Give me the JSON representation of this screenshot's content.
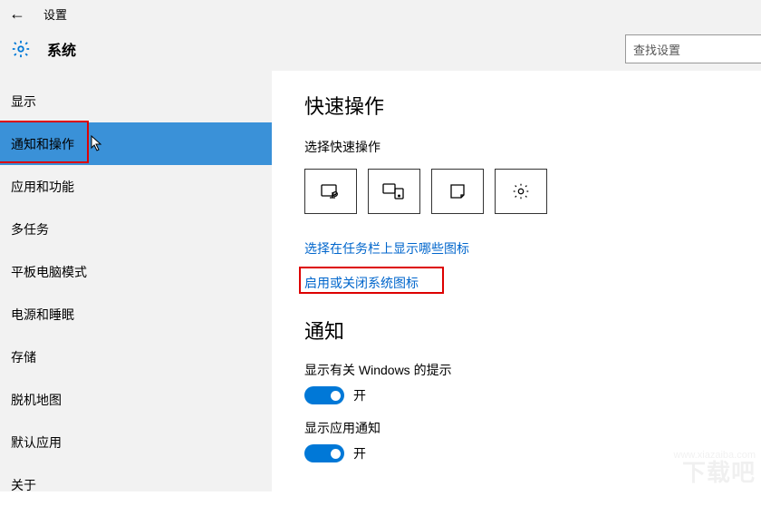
{
  "header": {
    "title": "设置",
    "section": "系统",
    "search_placeholder": "查找设置"
  },
  "sidebar": {
    "items": [
      {
        "label": "显示"
      },
      {
        "label": "通知和操作"
      },
      {
        "label": "应用和功能"
      },
      {
        "label": "多任务"
      },
      {
        "label": "平板电脑模式"
      },
      {
        "label": "电源和睡眠"
      },
      {
        "label": "存储"
      },
      {
        "label": "脱机地图"
      },
      {
        "label": "默认应用"
      },
      {
        "label": "关于"
      }
    ],
    "selected_index": 1
  },
  "content": {
    "quick_actions_heading": "快速操作",
    "quick_actions_sub": "选择快速操作",
    "tiles": [
      "tablet-mode-icon",
      "connect-icon",
      "note-icon",
      "settings-icon"
    ],
    "link_taskbar": "选择在任务栏上显示哪些图标",
    "link_system_icons": "启用或关闭系统图标",
    "notifications_heading": "通知",
    "toggles": [
      {
        "label": "显示有关 Windows 的提示",
        "state": "开",
        "on": true
      },
      {
        "label": "显示应用通知",
        "state": "开",
        "on": true
      }
    ]
  },
  "watermark": {
    "big": "下载吧",
    "small": "www.xiazaiba.com"
  }
}
